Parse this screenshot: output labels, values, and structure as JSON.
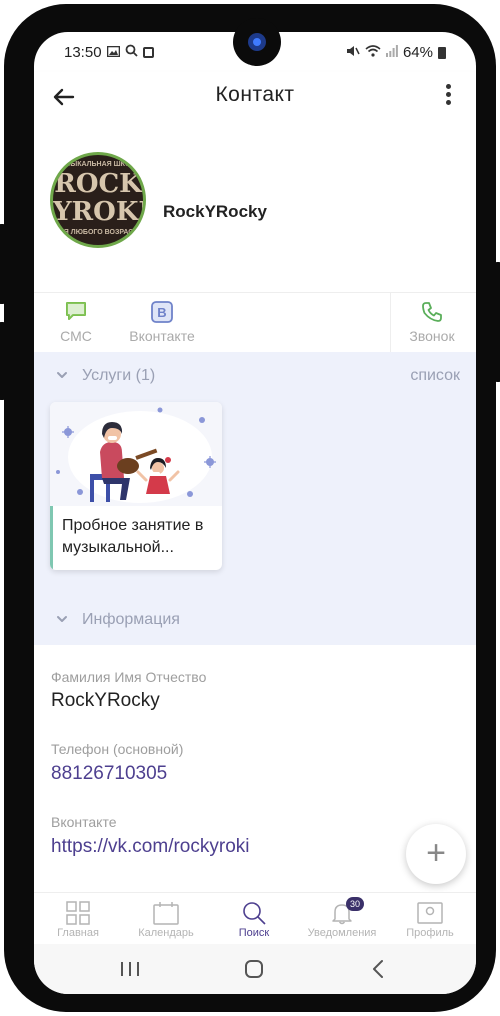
{
  "status_bar": {
    "time": "13:50",
    "battery": "64%",
    "icons": [
      "image-icon",
      "search-icon",
      "app-icon",
      "mute-icon",
      "wifi-icon",
      "signal-icon",
      "battery-icon"
    ]
  },
  "app_bar": {
    "title": "Контакт",
    "back_icon": "arrow-left-icon",
    "menu_icon": "more-vert-icon"
  },
  "contact": {
    "name": "RockYRocky",
    "avatar_logo": {
      "top": "МУЗЫКАЛЬНАЯ ШКОЛА",
      "line1": "ROCK",
      "line2": "YROKI",
      "bottom": "ДЛЯ ЛЮБОГО ВОЗРАСТА"
    }
  },
  "actions": [
    {
      "label": "СМС",
      "icon": "sms-icon",
      "color": "#7bbf4e"
    },
    {
      "label": "Вконтакте",
      "icon": "vk-icon",
      "color": "#6f82c9"
    },
    {
      "label": "Звонок",
      "icon": "phone-icon",
      "color": "#5aae5a"
    }
  ],
  "services_section": {
    "title": "Услуги (1)",
    "link": "список",
    "items": [
      {
        "title": "Пробное занятие в музыкальной..."
      }
    ]
  },
  "info_section": {
    "title": "Информация",
    "fields": [
      {
        "label": "Фамилия Имя Отчество",
        "value": "RockYRocky"
      },
      {
        "label": "Телефон  (основной)",
        "value": "88126710305"
      },
      {
        "label": "Вконтакте",
        "value": "https://vk.com/rockyroki"
      }
    ]
  },
  "fab": {
    "label": "+"
  },
  "bottom_nav": [
    {
      "label": "Главная",
      "icon": "grid-icon"
    },
    {
      "label": "Календарь",
      "icon": "calendar-icon"
    },
    {
      "label": "Поиск",
      "icon": "search-icon",
      "active": true
    },
    {
      "label": "Уведомления",
      "icon": "bell-icon",
      "badge": "30"
    },
    {
      "label": "Профиль",
      "icon": "profile-icon"
    }
  ],
  "colors": {
    "accent": "#4d3f8f",
    "section_bg": "#eef1fb",
    "muted": "#9aa0b4"
  }
}
